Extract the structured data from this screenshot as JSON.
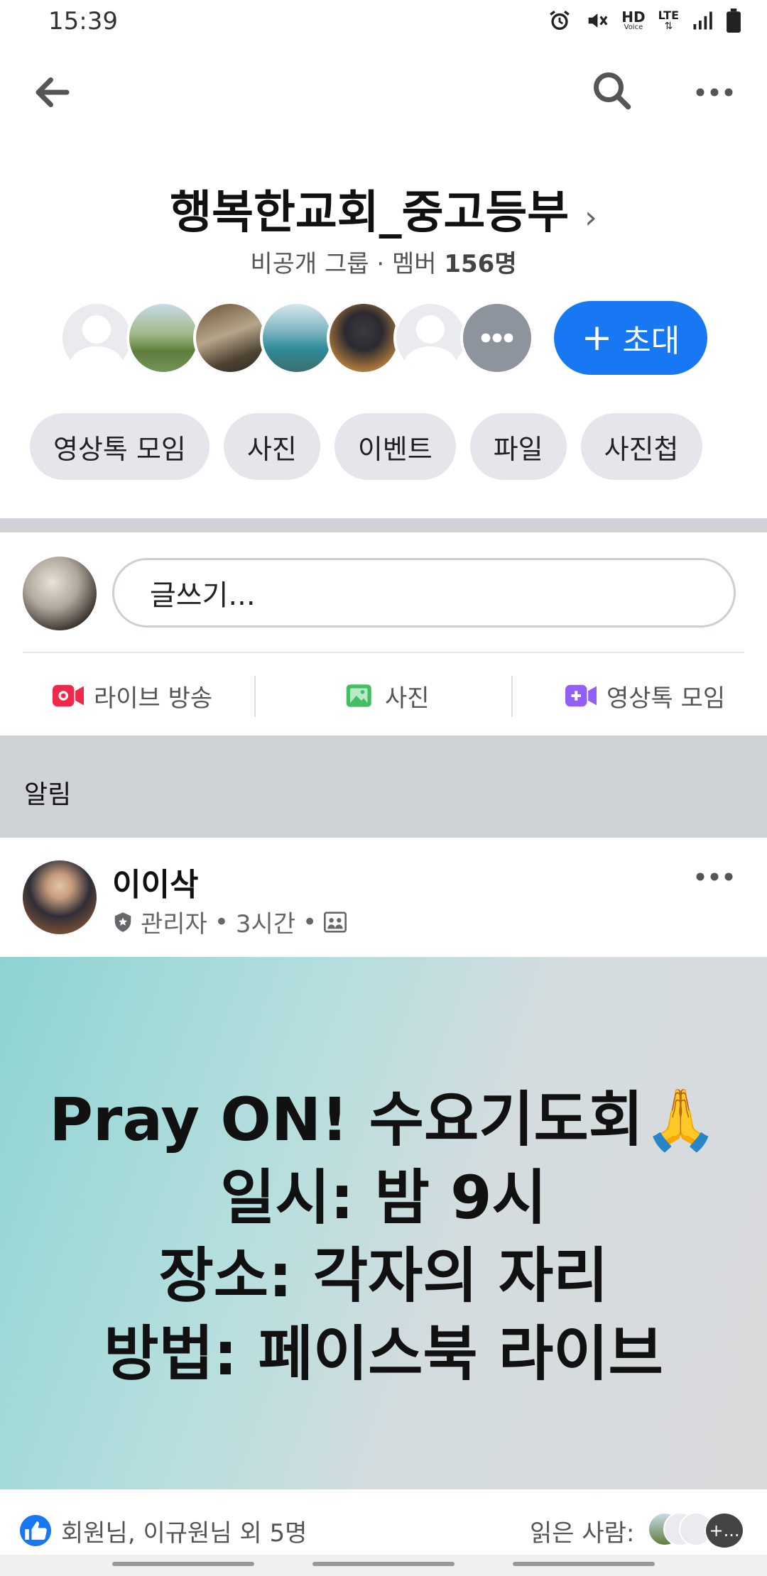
{
  "status_bar": {
    "time": "15:39",
    "hd": "HD",
    "hd_sub": "Voice",
    "network": "LTE"
  },
  "group": {
    "title": "행복한교회_중고등부",
    "privacy": "비공개 그룹 · 멤버 ",
    "members": "156명"
  },
  "invite_button": {
    "label": "초대"
  },
  "chips": [
    "영상톡 모임",
    "사진",
    "이벤트",
    "파일",
    "사진첩"
  ],
  "composer": {
    "placeholder": "글쓰기..."
  },
  "composer_actions": {
    "live": "라이브 방송",
    "photo": "사진",
    "video_chat": "영상톡 모임"
  },
  "alerts": {
    "label": "알림"
  },
  "post": {
    "author": "이이삭",
    "role": "관리자",
    "time": "3시간",
    "lines": [
      "Pray ON! 수요기도회🙏",
      "일시: 밤 9시",
      "장소: 각자의 자리",
      "방법: 페이스북 라이브"
    ]
  },
  "reactions": {
    "text": "회원님, 이규원님 외 5명",
    "readers_label": "읽은 사람:",
    "more": "+..."
  },
  "colors": {
    "brand": "#1877f2",
    "live_red": "#f02849",
    "photo_green": "#45bd62",
    "video_purple": "#9360f7"
  }
}
